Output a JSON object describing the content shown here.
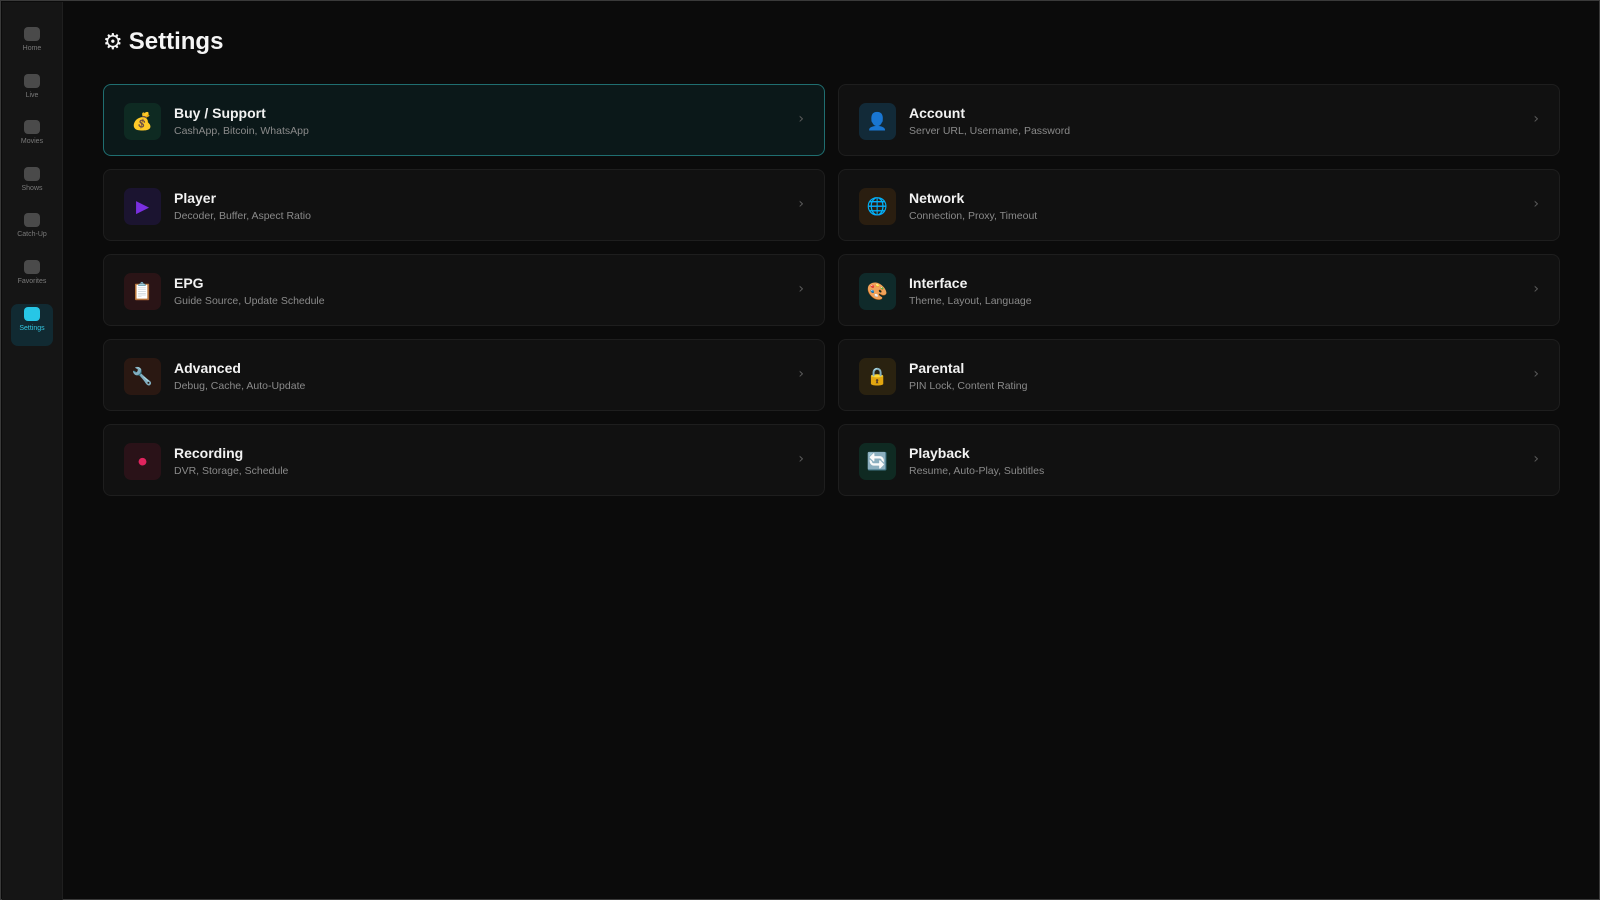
{
  "sidebar": {
    "items": [
      {
        "label": "Home",
        "icon": "home-icon",
        "active": false
      },
      {
        "label": "Live",
        "icon": "live-icon",
        "active": false
      },
      {
        "label": "Movies",
        "icon": "movies-icon",
        "active": false
      },
      {
        "label": "Shows",
        "icon": "shows-icon",
        "active": false
      },
      {
        "label": "Catch-Up",
        "icon": "catch-up-icon",
        "active": false
      },
      {
        "label": "Favorites",
        "icon": "favorites-icon",
        "active": false
      },
      {
        "label": "Settings",
        "icon": "settings-icon",
        "active": true
      }
    ]
  },
  "page": {
    "title": "Settings",
    "title_icon": "⚙"
  },
  "settings": [
    {
      "title": "Buy / Support",
      "subtitle": "CashApp, Bitcoin, WhatsApp",
      "icon": "💰",
      "icon_name": "money-bag-icon",
      "tile_color": "#0e2a22"
    },
    {
      "title": "Account",
      "subtitle": "Server URL, Username, Password",
      "icon": "👤",
      "icon_name": "user-icon",
      "tile_color": "#122a38"
    },
    {
      "title": "Player",
      "subtitle": "Decoder, Buffer, Aspect Ratio",
      "icon": "▶",
      "icon_name": "play-icon",
      "tile_color": "#1b1430"
    },
    {
      "title": "Network",
      "subtitle": "Connection, Proxy, Timeout",
      "icon": "🌐",
      "icon_name": "globe-icon",
      "tile_color": "#2a1e10"
    },
    {
      "title": "EPG",
      "subtitle": "Guide Source, Update Schedule",
      "icon": "📋",
      "icon_name": "clipboard-icon",
      "tile_color": "#2a1416"
    },
    {
      "title": "Interface",
      "subtitle": "Theme, Layout, Language",
      "icon": "🎨",
      "icon_name": "palette-icon",
      "tile_color": "#0f2a2a"
    },
    {
      "title": "Advanced",
      "subtitle": "Debug, Cache, Auto-Update",
      "icon": "🔧",
      "icon_name": "wrench-icon",
      "tile_color": "#2a1812"
    },
    {
      "title": "Parental",
      "subtitle": "PIN Lock, Content Rating",
      "icon": "🔒",
      "icon_name": "lock-icon",
      "tile_color": "#2a2210"
    },
    {
      "title": "Recording",
      "subtitle": "DVR, Storage, Schedule",
      "icon": "⏺",
      "icon_name": "record-icon",
      "tile_color": "#2a1218"
    },
    {
      "title": "Playback",
      "subtitle": "Resume, Auto-Play, Subtitles",
      "icon": "🔄",
      "icon_name": "repeat-icon",
      "tile_color": "#0f2a22"
    }
  ],
  "chevron": "›",
  "colors": {
    "accent": "#27c6e6",
    "active_card_border": "#1f6e70",
    "play_icon": "#7a2fe0",
    "record_icon": "#e0245e"
  }
}
